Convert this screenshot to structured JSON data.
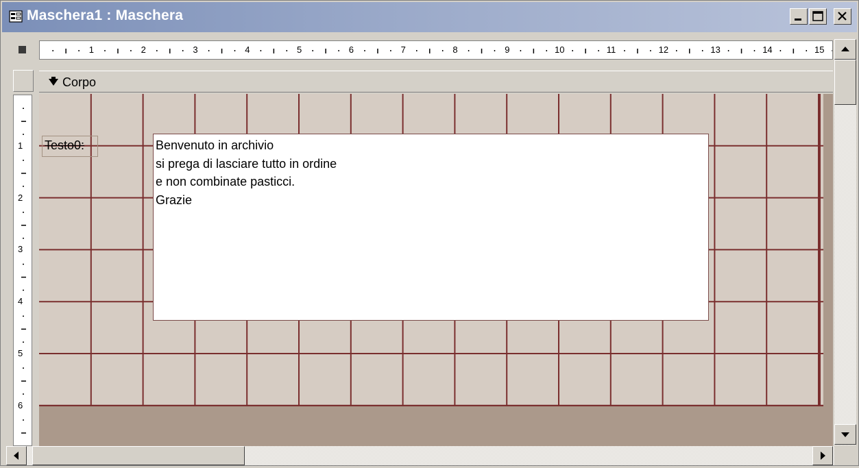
{
  "window": {
    "title": "Maschera1 : Maschera",
    "icon": "form-icon"
  },
  "title_buttons": {
    "minimize_icon": "minimize-icon",
    "maximize_icon": "maximize-icon",
    "close_icon": "close-icon"
  },
  "ruler": {
    "horizontal_numbers": [
      "1",
      "2",
      "3",
      "4",
      "5",
      "6",
      "7",
      "8",
      "9",
      "10",
      "11",
      "12",
      "13",
      "14",
      "15"
    ],
    "vertical_numbers": [
      "1",
      "2",
      "3",
      "4",
      "5",
      "6"
    ]
  },
  "section": {
    "label": "Corpo",
    "icon": "section-arrow-icon"
  },
  "label_control": {
    "text": "Testo0:"
  },
  "textbox": {
    "lines": [
      "Benvenuto in archivio",
      "si prega di lasciare tutto in ordine",
      "e non combinate pasticci.",
      "Grazie"
    ]
  },
  "colors": {
    "grid_line": "#7a2e2e",
    "grid_bg": "#d6ccc3",
    "canvas_bg": "#ab998b",
    "titlebar": "#7b8fb8"
  }
}
